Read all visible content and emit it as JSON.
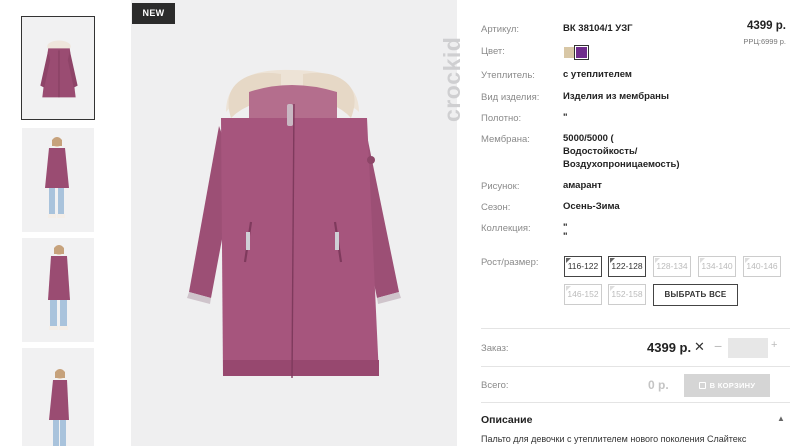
{
  "badge": "NEW",
  "brand": "crockid",
  "thumbnails": [
    {
      "view": "coat-front"
    },
    {
      "view": "model-front"
    },
    {
      "view": "model-front-2"
    },
    {
      "view": "model-side"
    }
  ],
  "specs": {
    "article_label": "Артикул:",
    "article_value": "ВК 38104/1 УЗГ",
    "color_label": "Цвет:",
    "colors": [
      "#d8c7a6",
      "#6f2c8c"
    ],
    "insulation_label": "Утеплитель:",
    "insulation_value": "с утеплителем",
    "type_label": "Вид изделия:",
    "type_value": "Изделия из мембраны",
    "fabric_label": "Полотно:",
    "fabric_value": "\"",
    "membrane_label": "Мембрана:",
    "membrane_value_1": "5000/5000 (",
    "membrane_value_2": "Водостойкость/",
    "membrane_value_3": "Воздухопроницаемость)",
    "pattern_label": "Рисунок:",
    "pattern_value": "амарант",
    "season_label": "Сезон:",
    "season_value": "Осень-Зима",
    "collection_label": "Коллекция:",
    "collection_value_1": "\"",
    "collection_value_2": "\""
  },
  "price": {
    "current": "4399 р.",
    "rrp": "РРЦ:6999 р."
  },
  "sizes": {
    "label": "Рост/размер:",
    "options": [
      {
        "label": "116-122",
        "available": true
      },
      {
        "label": "122-128",
        "available": true
      },
      {
        "label": "128-134",
        "available": false
      },
      {
        "label": "134-140",
        "available": false
      },
      {
        "label": "140-146",
        "available": false
      },
      {
        "label": "146-152",
        "available": false
      },
      {
        "label": "152-158",
        "available": false
      }
    ],
    "select_all": "ВЫБРАТЬ ВСЕ"
  },
  "order": {
    "label": "Заказ:",
    "price": "4399 р.",
    "remove": "✕",
    "minus": "−",
    "plus": "+"
  },
  "total": {
    "label": "Всего:",
    "value": "0 р.",
    "cart_button": "В КОРЗИНУ"
  },
  "description": {
    "title": "Описание",
    "toggle": "▲",
    "text": "Пальто для девочки с утеплителем нового поколения Слайтекс"
  }
}
